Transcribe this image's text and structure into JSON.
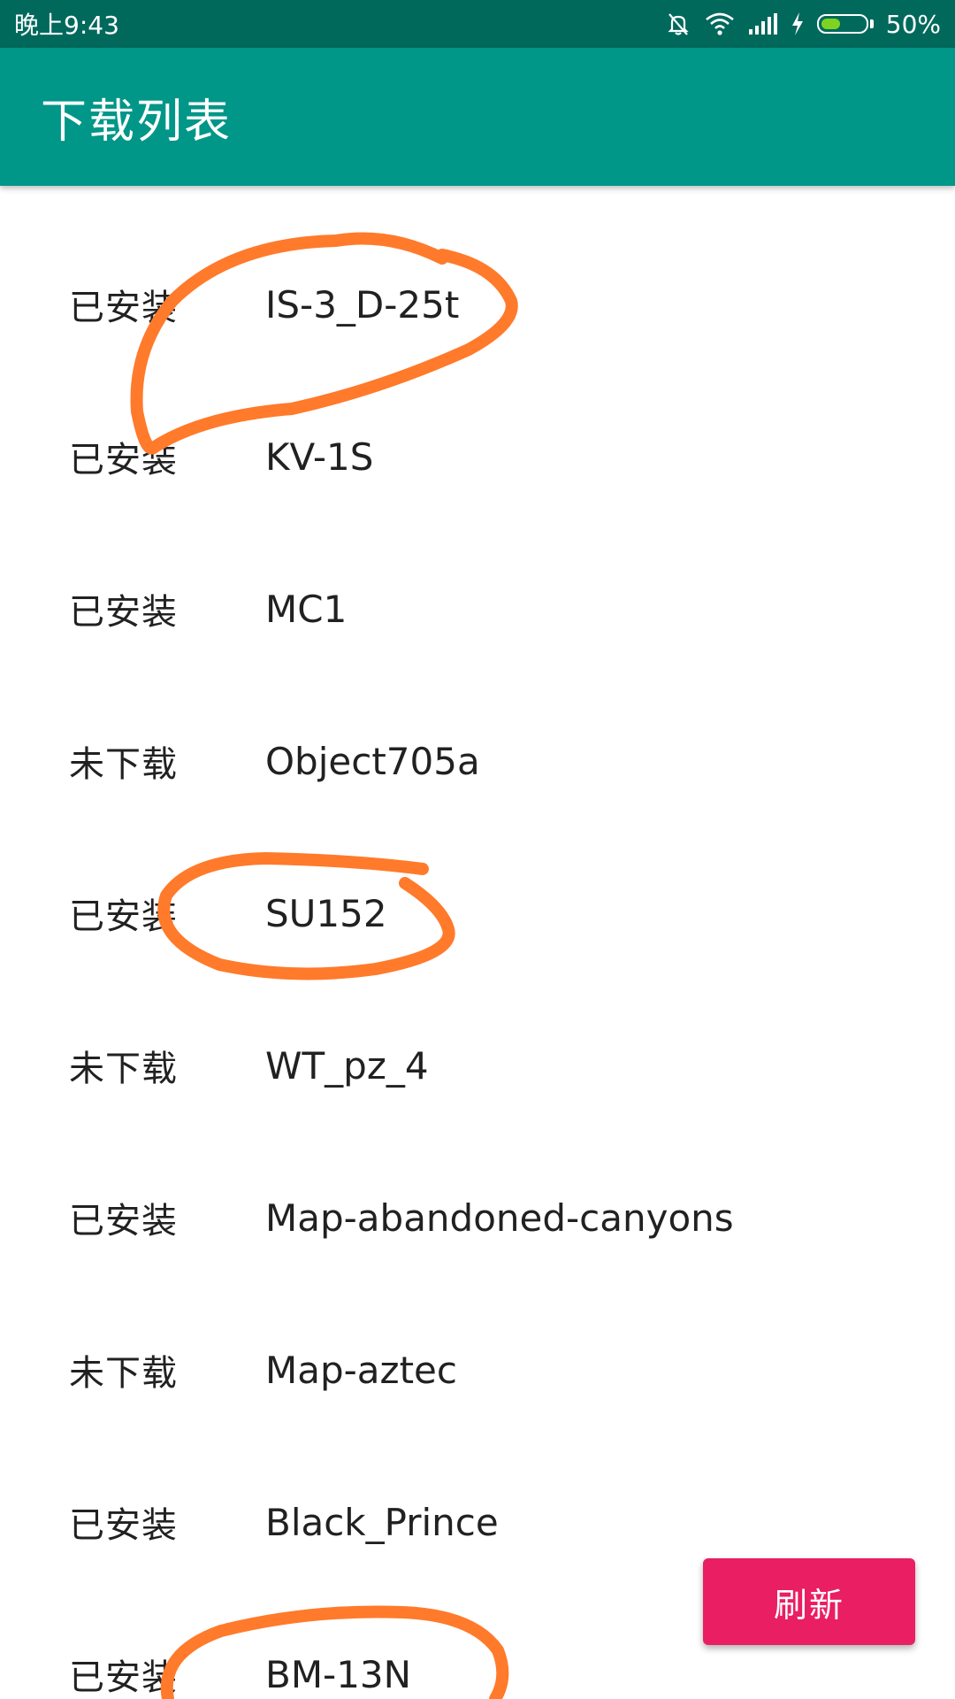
{
  "status_bar": {
    "time": "晚上9:43",
    "battery_percent": "50%",
    "battery_level": 0.5,
    "icons": [
      "mute-notification-icon",
      "wifi-icon",
      "signal-icon",
      "charging-icon",
      "battery-icon"
    ]
  },
  "app_bar": {
    "title": "下载列表"
  },
  "list": {
    "items": [
      {
        "status": "已安装",
        "name": "IS-3_D-25t"
      },
      {
        "status": "已安装",
        "name": "KV-1S"
      },
      {
        "status": "已安装",
        "name": "MC1"
      },
      {
        "status": "未下载",
        "name": "Object705a"
      },
      {
        "status": "已安装",
        "name": "SU152"
      },
      {
        "status": "未下载",
        "name": "WT_pz_4"
      },
      {
        "status": "已安装",
        "name": "Map-abandoned-canyons"
      },
      {
        "status": "未下载",
        "name": "Map-aztec"
      },
      {
        "status": "已安装",
        "name": "Black_Prince"
      },
      {
        "status": "已安装",
        "name": "BM-13N"
      }
    ]
  },
  "refresh_button": {
    "label": "刷新"
  },
  "colors": {
    "status_bar": "#00695c",
    "app_bar": "#009688",
    "accent_button": "#e91e63",
    "annotation": "#ff7a2b",
    "battery_fill": "#7ed321"
  }
}
